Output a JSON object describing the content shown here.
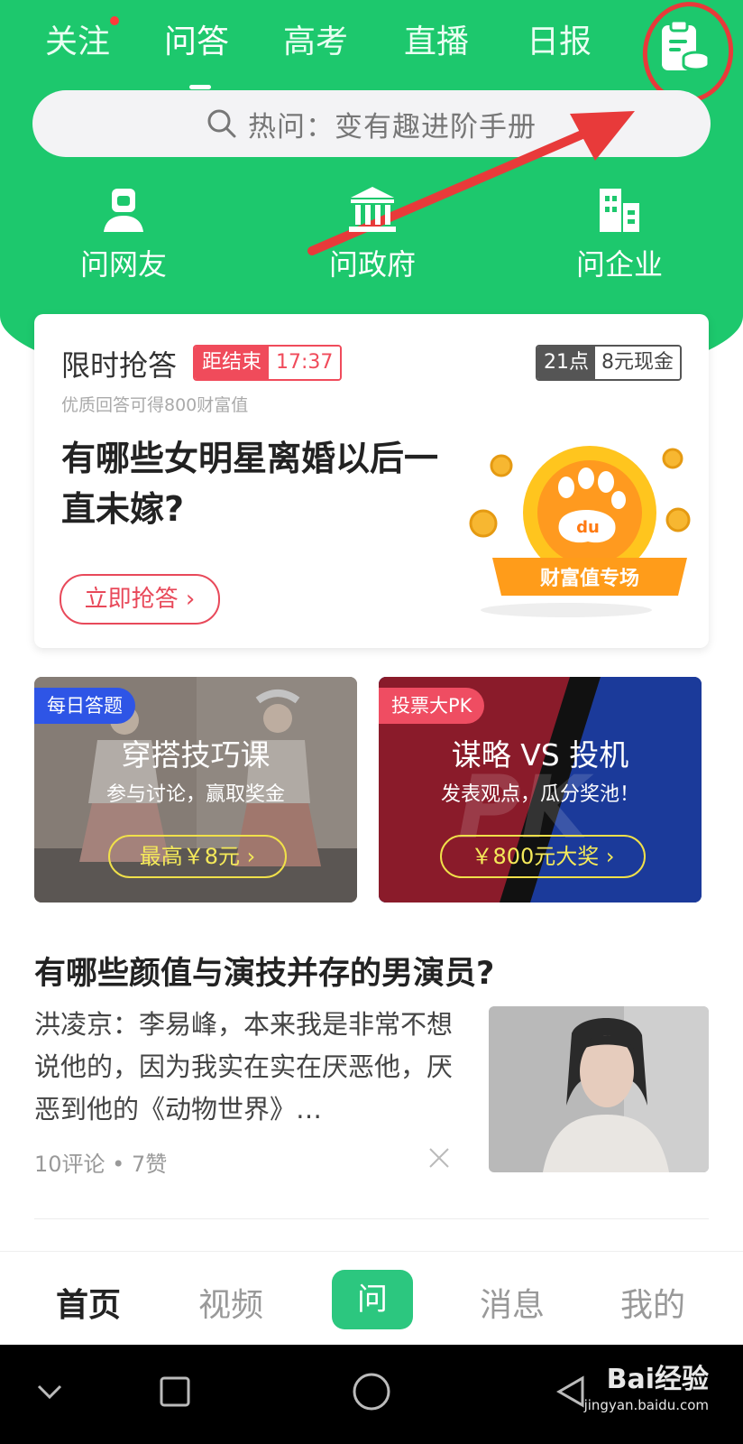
{
  "colors": {
    "brand_green": "#1dc86d",
    "alert_red": "#f04b5b",
    "annotation_red": "#e83a3a",
    "promo_yellow": "#f4e95a"
  },
  "tabs": [
    {
      "label": "关注",
      "has_dot": true
    },
    {
      "label": "问答",
      "active": true
    },
    {
      "label": "高考"
    },
    {
      "label": "直播"
    },
    {
      "label": "日报"
    }
  ],
  "header": {
    "task_icon": "task-clipboard-coin-icon",
    "annotation": "red circle and arrow pointing to task icon"
  },
  "search": {
    "placeholder": "热问：变有趣进阶手册",
    "icon": "search-icon"
  },
  "ask_categories": [
    {
      "label": "问网友",
      "icon": "person-icon"
    },
    {
      "label": "问政府",
      "icon": "government-building-icon"
    },
    {
      "label": "问企业",
      "icon": "office-building-icon"
    }
  ],
  "rush": {
    "title": "限时抢答",
    "countdown_label": "距结束",
    "countdown_time": "17:37",
    "reward_time": "21点",
    "reward_amount": "8元现金",
    "subtitle": "优质回答可得800财富值",
    "question": "有哪些女明星离婚以后一直未嫁?",
    "button": "立即抢答",
    "badge_mark": "du",
    "badge_ribbon": "财富值专场"
  },
  "promos": [
    {
      "tag": "每日答题",
      "title": "穿搭技巧课",
      "subtitle": "参与讨论，赢取奖金",
      "button": "最高￥8元"
    },
    {
      "tag": "投票大PK",
      "title": "谋略 VS 投机",
      "subtitle": "发表观点，瓜分奖池！",
      "button": "￥800元大奖",
      "bg_text": "PK"
    }
  ],
  "article": {
    "title": "有哪些颜值与演技并存的男演员?",
    "excerpt": "洪凌京：李易峰，本来我是非常不想说他的，因为我实在实在厌恶他，厌恶到他的《动物世界》…",
    "meta": "10评论 • 7赞"
  },
  "bottom_nav": [
    {
      "label": "首页",
      "active": true
    },
    {
      "label": "视频"
    },
    {
      "label": "问",
      "center": true
    },
    {
      "label": "消息"
    },
    {
      "label": "我的"
    }
  ],
  "watermark": {
    "main": "Bai经验",
    "url": "jingyan.baidu.com"
  }
}
